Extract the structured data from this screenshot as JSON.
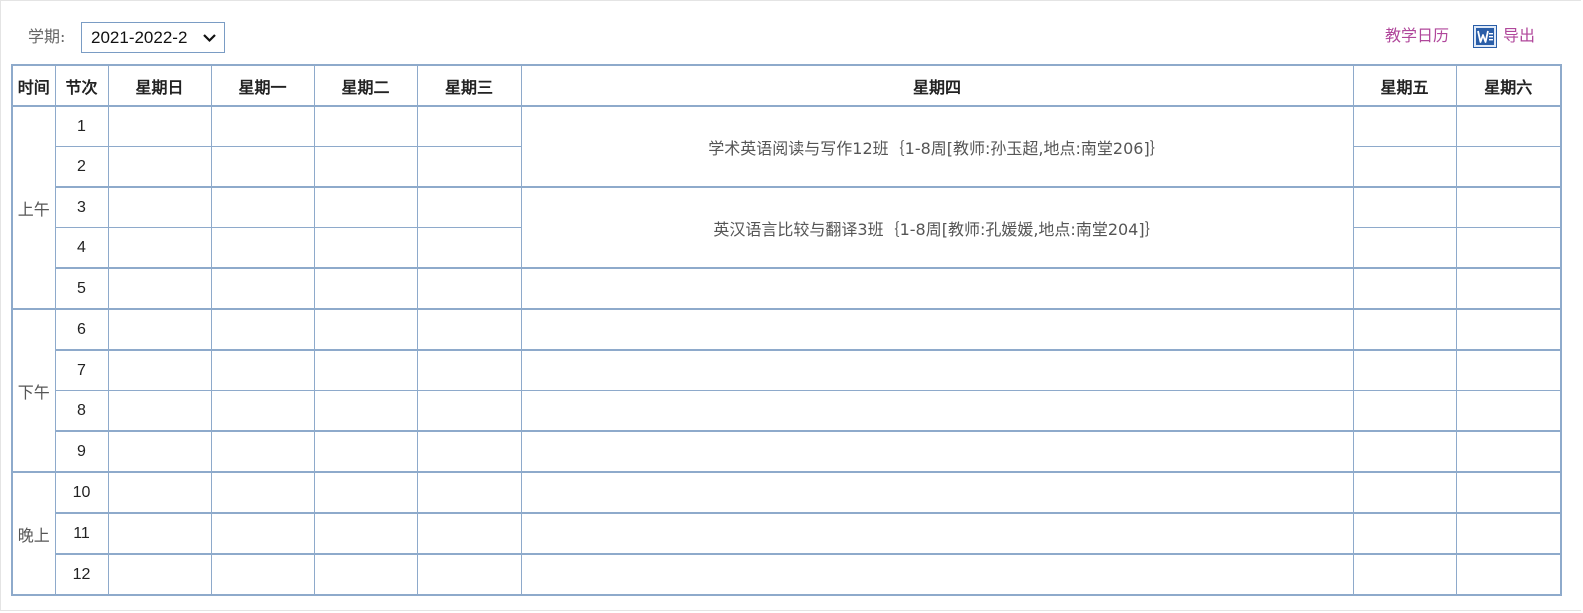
{
  "header": {
    "term_label": "学期:",
    "term_value": "2021-2022-2",
    "calendar_link": "教学日历",
    "export_label": "导出",
    "export_icon": "word-icon"
  },
  "table": {
    "headers": [
      "时间",
      "节次",
      "星期日",
      "星期一",
      "星期二",
      "星期三",
      "星期四",
      "星期五",
      "星期六"
    ],
    "time_blocks": {
      "morning": "上午",
      "afternoon": "下午",
      "evening": "晚上"
    },
    "periods": [
      "1",
      "2",
      "3",
      "4",
      "5",
      "6",
      "7",
      "8",
      "9",
      "10",
      "11",
      "12"
    ],
    "courses": [
      {
        "day": "星期四",
        "periods": "1-2",
        "text": "学术英语阅读与写作12班｛1-8周[教师:孙玉超,地点:南堂206]｝"
      },
      {
        "day": "星期四",
        "periods": "3-4",
        "text": "英汉语言比较与翻译3班｛1-8周[教师:孔媛媛,地点:南堂204]｝"
      }
    ]
  },
  "colors": {
    "border": "#8eaacb",
    "link": "#b0479b",
    "select_border": "#7a9cc4"
  }
}
